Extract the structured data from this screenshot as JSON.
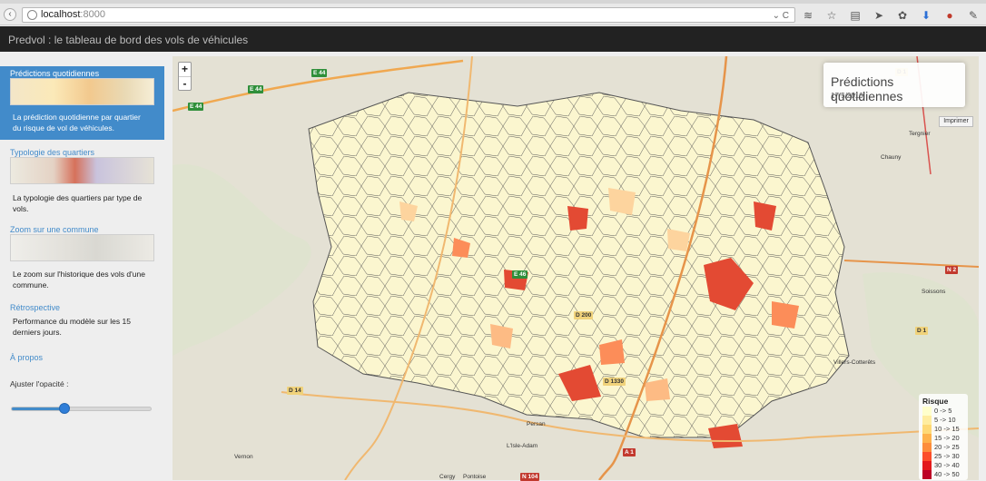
{
  "browser": {
    "url_host": "localhost",
    "url_port": ":8000"
  },
  "app": {
    "title": "Predvol : le tableau de bord des vols de véhicules"
  },
  "sidebar": {
    "items": [
      {
        "label": "Prédictions quotidiennes",
        "desc": "La prédiction quotidienne par quartier du risque de vol de véhicules.",
        "active": true
      },
      {
        "label": "Typologie des quartiers",
        "desc": "La typologie des quartiers par type de vols.",
        "active": false
      },
      {
        "label": "Zoom sur une commune",
        "desc": "Le zoom sur l'historique des vols d'une commune.",
        "active": false
      },
      {
        "label": "Rétrospective",
        "desc": "Performance du modèle sur les 15 derniers jours.",
        "active": false
      },
      {
        "label": "À propos",
        "active": false
      }
    ],
    "opacity_label": "Ajuster l'opacité :",
    "opacity_value": 0.38
  },
  "map": {
    "zoom_in": "+",
    "zoom_out": "-",
    "info_title": "Prédictions quotidiennes",
    "info_date": "17/5/2016",
    "print_label": "Imprimer",
    "legend": {
      "title": "Risque",
      "rows": [
        {
          "label": "0 -> 5",
          "color": "#ffffcc"
        },
        {
          "label": "5 -> 10",
          "color": "#ffeda0"
        },
        {
          "label": "10 -> 15",
          "color": "#fed976"
        },
        {
          "label": "15 -> 20",
          "color": "#feb24c"
        },
        {
          "label": "20 -> 25",
          "color": "#fd8d3c"
        },
        {
          "label": "25 -> 30",
          "color": "#fc4e2a"
        },
        {
          "label": "30 -> 40",
          "color": "#e31a1c"
        },
        {
          "label": "40 -> 50",
          "color": "#bd0026"
        }
      ]
    },
    "roads": [
      {
        "text": "E 44",
        "style": "green"
      },
      {
        "text": "E 44",
        "style": "green"
      },
      {
        "text": "E 44",
        "style": "green"
      },
      {
        "text": "E 46",
        "style": "green"
      },
      {
        "text": "N 2",
        "style": "red"
      },
      {
        "text": "D 1",
        "style": "yellow"
      },
      {
        "text": "D 14",
        "style": "yellow"
      },
      {
        "text": "A 1",
        "style": "red"
      },
      {
        "text": "N 104",
        "style": "red"
      },
      {
        "text": "D 1330",
        "style": "yellow"
      },
      {
        "text": "D 200",
        "style": "yellow"
      },
      {
        "text": "D 1",
        "style": "yellow"
      }
    ],
    "towns": [
      "Tergnier",
      "Chauny",
      "Soissons",
      "Villers-Cotterêts",
      "Persan",
      "L'Isle-Adam",
      "Vernon",
      "Cergy",
      "Pontoise"
    ]
  }
}
